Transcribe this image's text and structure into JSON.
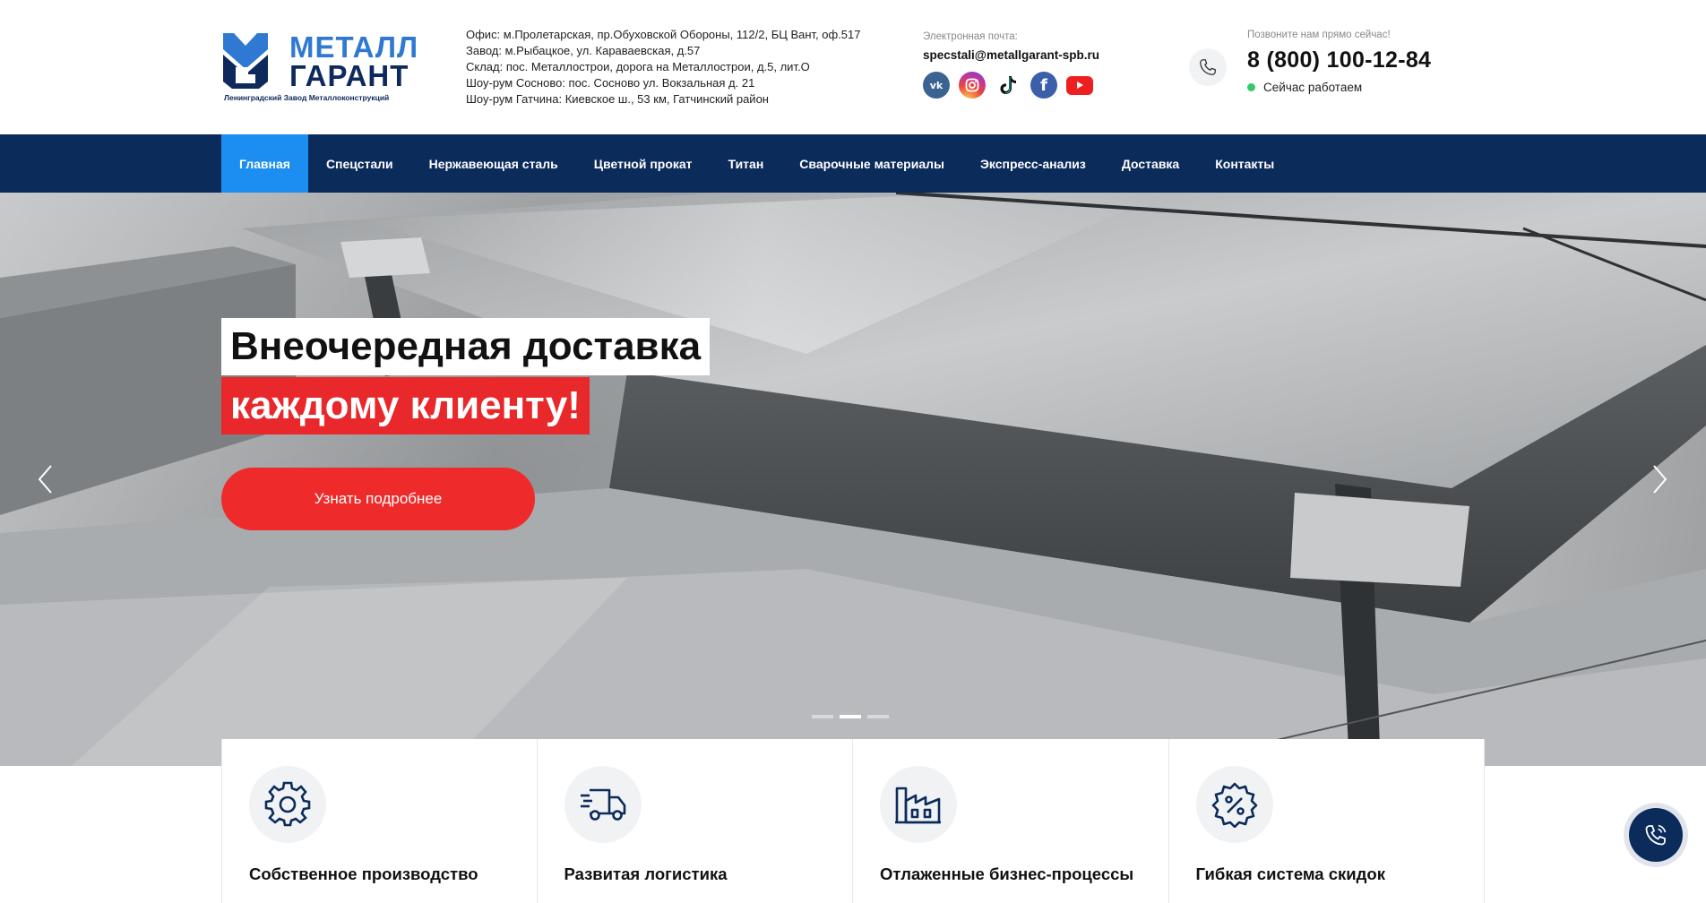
{
  "brand": {
    "name_line1": "МЕТАЛЛ",
    "name_line2": "ГАРАНТ",
    "subtitle": "Ленинградский Завод Металлоконструкций"
  },
  "addresses": [
    "Офис: м.Пролетарская, пр.Обуховской Обороны, 112/2, БЦ Вант, оф.517",
    "Завод: м.Рыбацкое, ул. Караваевская, д.57",
    "Склад: пос. Металлострои, дорога на Металлострои, д.5, лит.О",
    "Шоу-рум Сосново: пос. Сосново ул. Вокзальная д. 21",
    "Шоу-рум Гатчина: Киевское ш., 53 км, Гатчинский район"
  ],
  "contact": {
    "email_label": "Электронная почта:",
    "email": "specstali@metallgarant-spb.ru",
    "socials": [
      "vk-icon",
      "instagram-icon",
      "tiktok-icon",
      "facebook-icon",
      "youtube-icon"
    ],
    "phone_label": "Позвоните нам прямо сейчас!",
    "phone": "8 (800) 100-12-84",
    "status": "Сейчас работаем",
    "status_color": "#37c86c"
  },
  "nav": {
    "items": [
      {
        "label": "Главная",
        "active": true
      },
      {
        "label": "Спецстали"
      },
      {
        "label": "Нержавеющая сталь"
      },
      {
        "label": "Цветной прокат"
      },
      {
        "label": "Титан"
      },
      {
        "label": "Сварочные материалы"
      },
      {
        "label": "Экспресс-анализ"
      },
      {
        "label": "Доставка"
      },
      {
        "label": "Контакты"
      }
    ]
  },
  "hero": {
    "title_line1": "Внеочередная доставка",
    "title_line2": "каждому клиенту!",
    "button": "Узнать подробнее",
    "slides_total": 3,
    "slide_active": 2
  },
  "features": [
    {
      "icon": "gear-icon",
      "title": "Собственное производство"
    },
    {
      "icon": "truck-icon",
      "title": "Развитая логистика"
    },
    {
      "icon": "factory-icon",
      "title": "Отлаженные бизнес-процессы"
    },
    {
      "icon": "discount-icon",
      "title": "Гибкая система скидок"
    }
  ],
  "colors": {
    "nav_bg": "#0b2b5b",
    "nav_active": "#1d8ef1",
    "accent_red": "#e8282b"
  }
}
